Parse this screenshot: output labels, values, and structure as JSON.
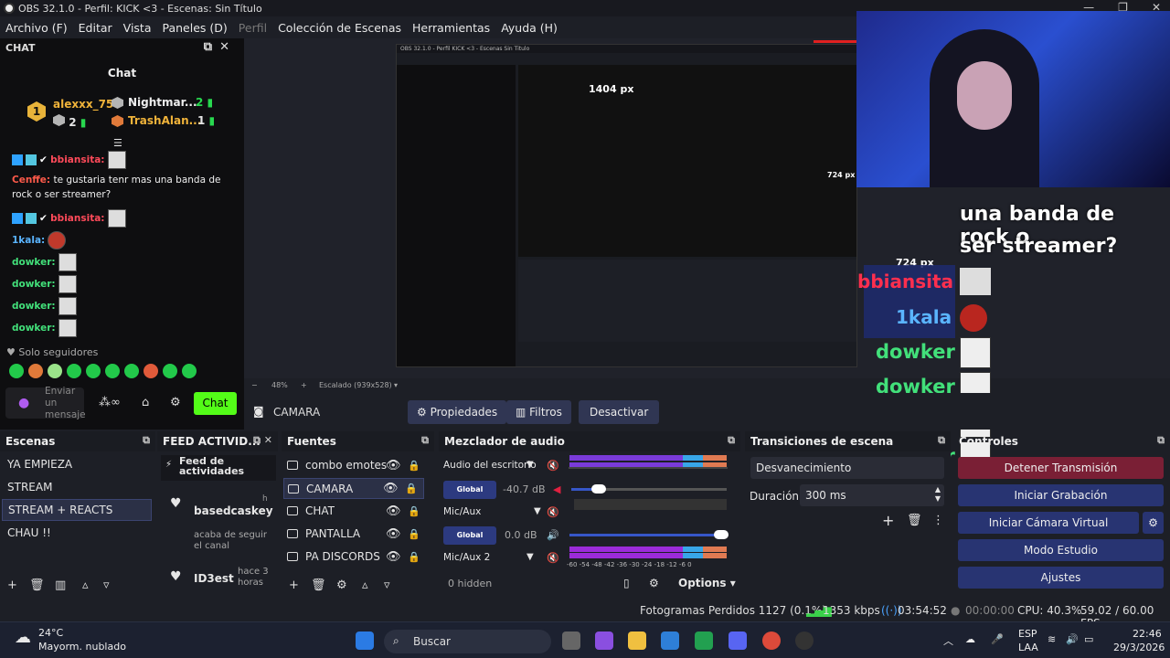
{
  "window": {
    "title": "OBS 32.1.0 - Perfil: KICK <3 - Escenas: Sin Título"
  },
  "menu": [
    "Archivo (F)",
    "Editar",
    "Vista",
    "Paneles (D)",
    "Perfil",
    "Colección de Escenas",
    "Herramientas",
    "Ayuda (H)"
  ],
  "chat": {
    "dock_title": "CHAT",
    "title": "Chat",
    "leaders": [
      {
        "rank": "1",
        "name": "alexxx_75",
        "count": "2"
      },
      {
        "name": "Nightmar...",
        "count": "2"
      },
      {
        "name": "TrashAlan...",
        "count": "1"
      }
    ],
    "messages": [
      {
        "user": "bbiansita:",
        "text": ""
      },
      {
        "user": "Cenffe:",
        "text": " te gustaria tenr mas una banda de rock o ser streamer?"
      },
      {
        "user": "bbiansita:",
        "text": ""
      },
      {
        "user": "1kala:",
        "text": ""
      },
      {
        "user": "dowker:",
        "text": ""
      },
      {
        "user": "dowker:",
        "text": ""
      },
      {
        "user": "dowker:",
        "text": ""
      },
      {
        "user": "dowker:",
        "text": ""
      }
    ],
    "followers_only": "Solo seguidores",
    "input_placeholder": "Enviar un mensaje",
    "send_button": "Chat"
  },
  "preview": {
    "nested_title": "OBS 32.1.0 - Perfil KICK <3 - Escenas Sin Titulo",
    "px1": "1404 px",
    "px2": "724 px",
    "px3": "724 px",
    "overlay_question_1": "una banda de rock o",
    "overlay_question_2": "ser streamer?",
    "overlay_user1": "bbiansita",
    "overlay_user2": "1kala",
    "overlay_dowker": "dowker"
  },
  "zoom": {
    "value": "48%",
    "scale": "Escalado (939x528)"
  },
  "source_toolbar": {
    "name": "CAMARA",
    "properties": "Propiedades",
    "filters": "Filtros",
    "deactivate": "Desactivar"
  },
  "scenes": {
    "title": "Escenas",
    "items": [
      "YA EMPIEZA",
      "STREAM",
      "STREAM + REACTS",
      "CHAU !!"
    ],
    "selected": 2
  },
  "feed": {
    "title": "FEED ACTIVID...",
    "header": "Feed de actividades",
    "items": [
      {
        "user": "basedcaskey",
        "time": "h",
        "text": "acaba de seguir el canal"
      },
      {
        "user": "ID3est",
        "time": "hace 3 horas",
        "text": ""
      }
    ]
  },
  "sources": {
    "title": "Fuentes",
    "items": [
      "combo emotes",
      "CAMARA",
      "CHAT",
      "PANTALLA",
      "PA DISCORDS"
    ],
    "selected": 1
  },
  "mixer": {
    "title": "Mezclador de audio",
    "channels": [
      {
        "name": "Audio del escritorio",
        "global": "Global",
        "db": "-40.7 dB",
        "level": 0.2
      },
      {
        "name": "Mic/Aux",
        "global": "Global",
        "db": "0.0 dB",
        "level": 1.0
      },
      {
        "name": "Mic/Aux 2"
      }
    ],
    "scale": "-60  -54  -48  -42  -36  -30  -24  -18  -12  -6  0",
    "hidden": "0 hidden",
    "options": "Options"
  },
  "transitions": {
    "title": "Transiciones de escena",
    "type": "Desvanecimiento",
    "duration_label": "Duración",
    "duration": "300 ms"
  },
  "controls": {
    "title": "Controles",
    "stop_stream": "Detener Transmisión",
    "start_rec": "Iniciar Grabación",
    "virtual_cam": "Iniciar Cámara Virtual",
    "studio": "Modo Estudio",
    "settings": "Ajustes"
  },
  "status": {
    "dropped": "Fotogramas Perdidos 1127 (0.1%)",
    "kbps": "1353 kbps",
    "live_time": "03:54:52",
    "rec_time": "00:00:00",
    "cpu": "CPU: 40.3%",
    "fps": "59.02 / 60.00 FPS"
  },
  "taskbar": {
    "temp": "24°C",
    "weather": "Mayorm. nublado",
    "search": "Buscar",
    "lang1": "ESP",
    "lang2": "LAA",
    "time": "22:46",
    "date": "29/3/2026"
  },
  "colors": {
    "kick_green": "#53fc18",
    "control_blue": "#283472",
    "stop_red": "#7a1f35"
  }
}
